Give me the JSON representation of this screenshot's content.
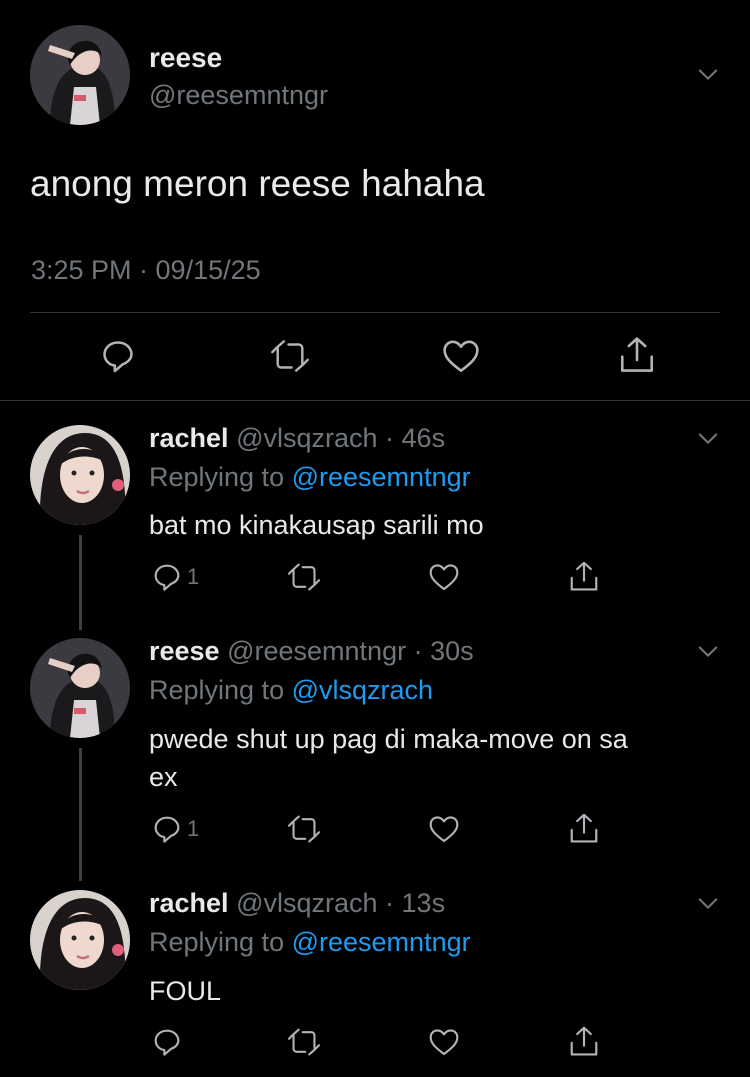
{
  "main_tweet": {
    "author_name": "reese",
    "author_handle": "@reesemntngr",
    "text": "anong meron reese hahaha",
    "timestamp": "3:25 PM · 09/15/25",
    "actions": [
      "reply-icon",
      "retweet-icon",
      "like-icon",
      "share-icon"
    ]
  },
  "replies": [
    {
      "author_name": "rachel",
      "author_handle": "@vlsqzrach",
      "age": "· 46s",
      "replying_to_label": "Replying to",
      "replying_to_handle": "@reesemntngr",
      "text": "bat mo kinakausap sarili mo",
      "reply_count": "1"
    },
    {
      "author_name": "reese",
      "author_handle": "@reesemntngr",
      "age": "· 30s",
      "replying_to_label": "Replying to",
      "replying_to_handle": "@vlsqzrach",
      "text_line1": "pwede shut up pag di maka-move on sa",
      "text_line2": "ex",
      "reply_count": "1"
    },
    {
      "author_name": "rachel",
      "author_handle": "@vlsqzrach",
      "age": "· 13s",
      "replying_to_label": "Replying to",
      "replying_to_handle": "@reesemntngr",
      "text": "FOUL",
      "reply_count": ""
    }
  ],
  "colors": {
    "background": "#000000",
    "text": "#e7e9ea",
    "muted": "#71767b",
    "link": "#1d9bf0",
    "divider": "#2f3336"
  }
}
